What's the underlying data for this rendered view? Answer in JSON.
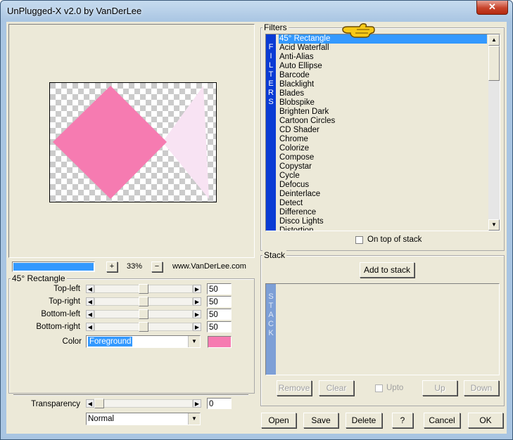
{
  "window": {
    "title": "UnPlugged-X v2.0 by VanDerLee",
    "close_glyph": "✕"
  },
  "preview": {
    "zoom_value": "33%",
    "zoom_in": "+",
    "zoom_out": "−",
    "website": "www.VanDerLee.com",
    "progress": 1.0,
    "colors": {
      "shape": "#f67bb1",
      "shape_light": "#f8e3f3",
      "progress": "#3399ff"
    }
  },
  "params": {
    "group_label": "45° Rectangle",
    "sliders": [
      {
        "label": "Top-left",
        "value": "50",
        "level": 0.5
      },
      {
        "label": "Top-right",
        "value": "50",
        "level": 0.5
      },
      {
        "label": "Bottom-left",
        "value": "50",
        "level": 0.5
      },
      {
        "label": "Bottom-right",
        "value": "50",
        "level": 0.5
      }
    ],
    "color_label": "Color",
    "color_value": "Foreground",
    "color_swatch": "#f67bb1"
  },
  "transparency": {
    "label": "Transparency",
    "value": "0",
    "level": 0.0,
    "blend_mode": "Normal"
  },
  "filters": {
    "group_label": "Filters",
    "stripe_letters": [
      "F",
      "I",
      "L",
      "T",
      "E",
      "R",
      "S"
    ],
    "items": [
      "45° Rectangle",
      "Acid Waterfall",
      "Anti-Alias",
      "Auto Ellipse",
      "Barcode",
      "Blacklight",
      "Blades",
      "Blobspike",
      "Brighten Dark",
      "Cartoon Circles",
      "CD Shader",
      "Chrome",
      "Colorize",
      "Compose",
      "Copystar",
      "Cycle",
      "Defocus",
      "Deinterlace",
      "Detect",
      "Difference",
      "Disco Lights",
      "Distortion"
    ],
    "selected_index": 0,
    "on_top_label": "On top of stack",
    "on_top_checked": false,
    "pointer_icon": "hand-pointer-icon"
  },
  "stack": {
    "group_label": "Stack",
    "add_button": "Add to stack",
    "stripe_letters": [
      "S",
      "T",
      "A",
      "C",
      "K"
    ],
    "remove_button": "Remove",
    "clear_button": "Clear",
    "upto_label": "Upto",
    "up_button": "Up",
    "down_button": "Down"
  },
  "footer": {
    "open": "Open",
    "save": "Save",
    "delete": "Delete",
    "help": "?",
    "cancel": "Cancel",
    "ok": "OK"
  }
}
